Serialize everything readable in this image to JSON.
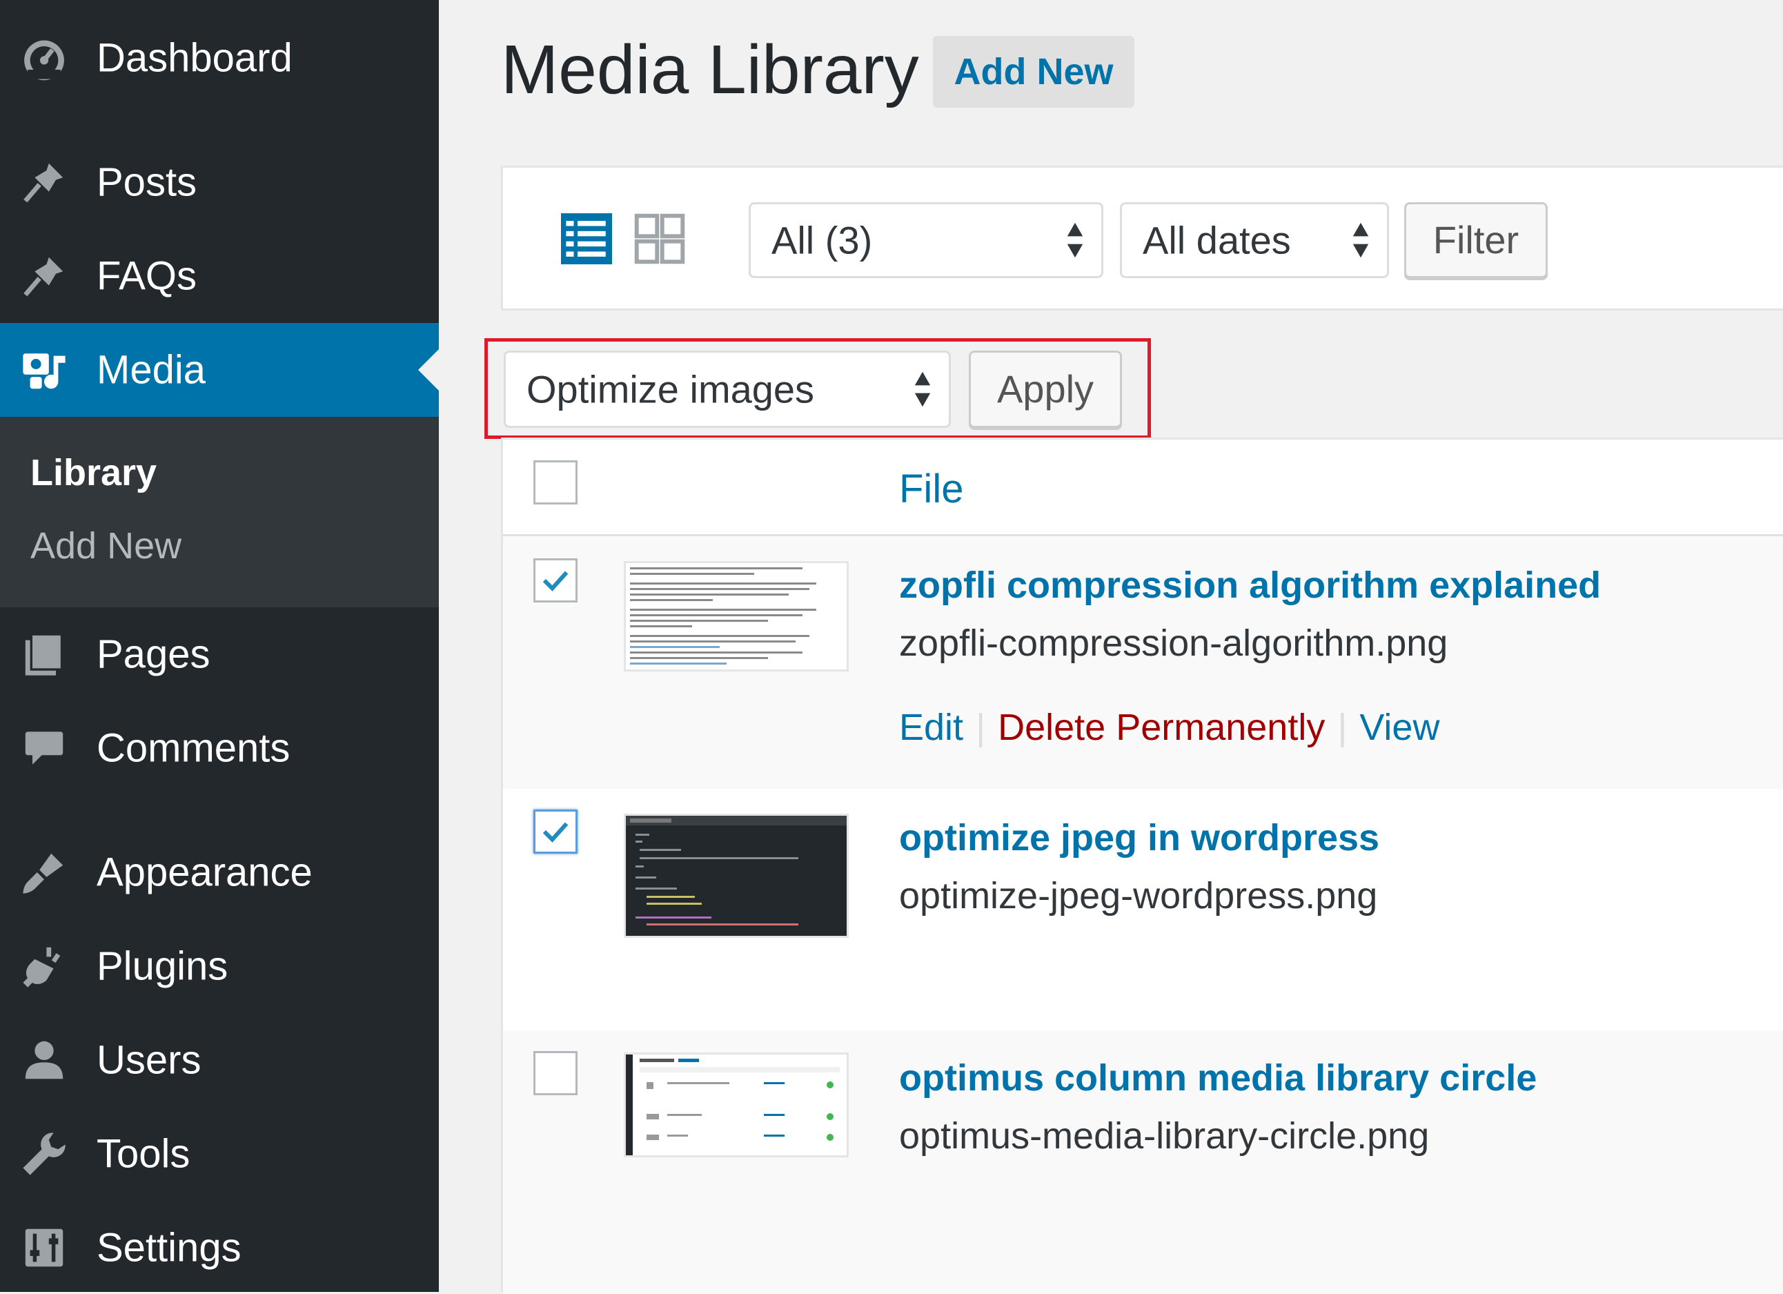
{
  "sidebar": {
    "items": [
      {
        "label": "Dashboard",
        "icon": "dashboard-icon"
      },
      {
        "label": "Posts",
        "icon": "pushpin-icon"
      },
      {
        "label": "FAQs",
        "icon": "pushpin-icon"
      },
      {
        "label": "Media",
        "icon": "media-icon",
        "current": true
      },
      {
        "label": "Pages",
        "icon": "pages-icon"
      },
      {
        "label": "Comments",
        "icon": "comment-bubble-icon"
      },
      {
        "label": "Appearance",
        "icon": "paintbrush-icon"
      },
      {
        "label": "Plugins",
        "icon": "plugin-icon"
      },
      {
        "label": "Users",
        "icon": "user-icon"
      },
      {
        "label": "Tools",
        "icon": "wrench-icon"
      },
      {
        "label": "Settings",
        "icon": "sliders-icon"
      }
    ],
    "submenu": {
      "library": "Library",
      "add_new": "Add New"
    }
  },
  "header": {
    "title": "Media Library",
    "add_new": "Add New"
  },
  "filters": {
    "type_select": "All (3)",
    "date_select": "All dates",
    "filter_button": "Filter"
  },
  "bulk": {
    "action_select": "Optimize images",
    "apply_button": "Apply"
  },
  "table": {
    "column_file": "File",
    "rows": [
      {
        "title": "zopfli compression algorithm explained",
        "filename": "zopfli-compression-algorithm.png",
        "checked": true,
        "actions": {
          "edit": "Edit",
          "delete": "Delete Permanently",
          "view": "View"
        }
      },
      {
        "title": "optimize jpeg in wordpress",
        "filename": "optimize-jpeg-wordpress.png",
        "checked": true
      },
      {
        "title": "optimus column media library circle",
        "filename": "optimus-media-library-circle.png",
        "checked": false
      }
    ]
  },
  "colors": {
    "sidebar_bg": "#23282d",
    "submenu_bg": "#32373c",
    "accent": "#0073aa",
    "delete": "#a00000",
    "highlight": "#dc1c2a"
  }
}
